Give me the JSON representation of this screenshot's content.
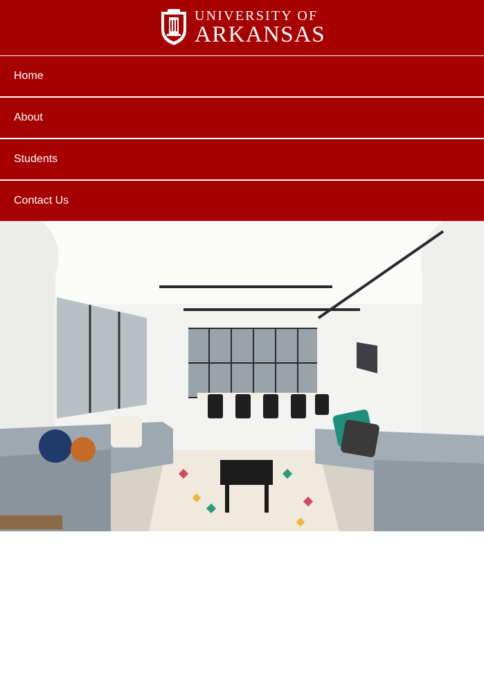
{
  "header": {
    "logo": {
      "line1": "UNIVERSITY OF",
      "line2": "ARKANSAS",
      "seal_icon": "university-seal-icon"
    }
  },
  "nav": {
    "items": [
      {
        "label": "Home"
      },
      {
        "label": "About"
      },
      {
        "label": "Students"
      },
      {
        "label": "Contact Us"
      }
    ]
  },
  "hero": {
    "image": "office-lounge-photo"
  },
  "colors": {
    "brand_red": "#a60000",
    "text_white": "#ffffff"
  }
}
